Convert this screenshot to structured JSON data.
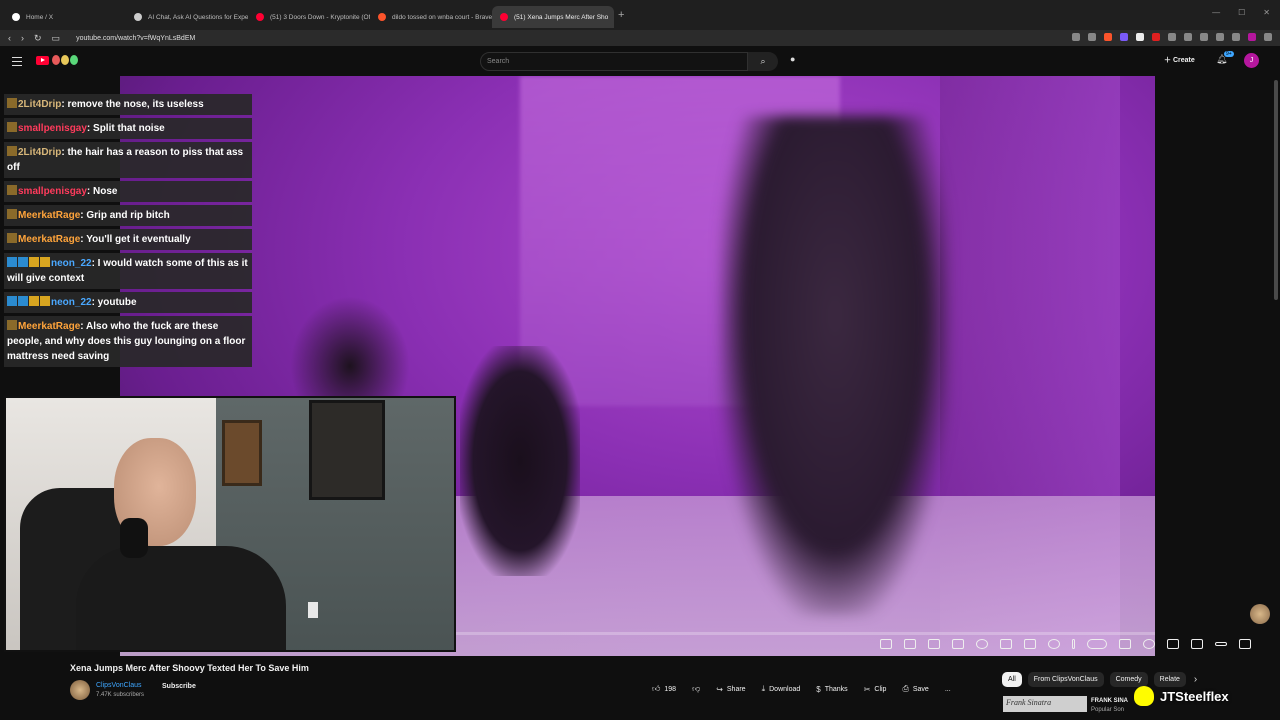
{
  "browser": {
    "tabs": [
      {
        "label": "Home / X",
        "fav": "#ffffff"
      },
      {
        "label": "AI Chat, Ask AI Questions for Expert",
        "fav": "#cccccc"
      },
      {
        "label": "(51) 3 Doors Down - Kryptonite (Offi",
        "fav": "#ff0033"
      },
      {
        "label": "dildo tossed on wnba court - Brave",
        "fav": "#fb542b"
      },
      {
        "label": "(51) Xena Jumps Merc After Sho",
        "fav": "#ff0033",
        "active": true
      }
    ],
    "url": "youtube.com/watch?v=fWqYnLsBdEM"
  },
  "header": {
    "search_placeholder": "Search",
    "create_label": "Create",
    "notif_count": "9+",
    "avatar_letter": "J"
  },
  "chat": [
    {
      "badges": [
        "tan"
      ],
      "user": "2Lit4Drip",
      "color": "u-tan",
      "text": ": remove the nose, its useless"
    },
    {
      "badges": [
        "tan"
      ],
      "user": "smallpenisgay",
      "color": "u-red",
      "text": ": Split that noise"
    },
    {
      "badges": [
        "tan"
      ],
      "user": "2Lit4Drip",
      "color": "u-tan",
      "text": ": the hair has a reason to piss that ass off"
    },
    {
      "badges": [
        "tan"
      ],
      "user": "smallpenisgay",
      "color": "u-red",
      "text": ": Nose"
    },
    {
      "badges": [
        "tan"
      ],
      "user": "MeerkatRage",
      "color": "u-orange",
      "text": ": Grip and rip bitch"
    },
    {
      "badges": [
        "tan"
      ],
      "user": "MeerkatRage",
      "color": "u-orange",
      "text": ": You'll get it eventually"
    },
    {
      "badges": [
        "blue",
        "blue",
        "gold",
        "gold"
      ],
      "user": "neon_22",
      "color": "u-blue",
      "text": ": I would watch some of this as it will give context"
    },
    {
      "badges": [
        "blue",
        "blue",
        "gold",
        "gold"
      ],
      "user": "neon_22",
      "color": "u-blue",
      "text": ": youtube"
    },
    {
      "badges": [
        "tan"
      ],
      "user": "MeerkatRage",
      "color": "u-orange",
      "text": ": Also who the fuck are these people, and why does this guy lounging on a floor mattress need saving"
    }
  ],
  "video": {
    "title": "Xena Jumps Merc After Shoovy Texted Her To Save Him",
    "channel": "ClipsVonClaus",
    "subscribers": "7.47K subscribers",
    "subscribe_label": "Subscribe",
    "likes": "198"
  },
  "actions": {
    "share": "Share",
    "download": "Download",
    "thanks": "Thanks",
    "clip": "Clip",
    "save": "Save",
    "more": "..."
  },
  "chips": [
    "All",
    "From ClipsVonClaus",
    "Comedy",
    "Relate"
  ],
  "rec": {
    "thumb_text": "Frank Sinatra",
    "title": "FRANK SINA",
    "subtitle": "Popular Son"
  },
  "overlay": {
    "handle": "JTSteelflex"
  }
}
